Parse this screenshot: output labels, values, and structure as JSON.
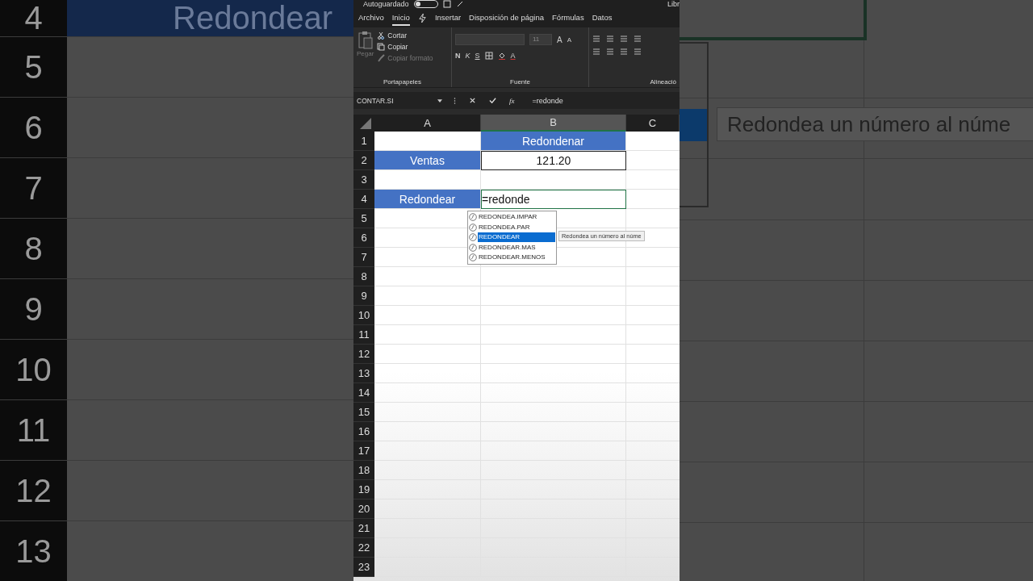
{
  "backdrop_left": {
    "cell_text": "Redondear",
    "row_numbers": [
      "4",
      "5",
      "6",
      "7",
      "8",
      "9",
      "10",
      "11",
      "12",
      "13"
    ]
  },
  "backdrop_right": {
    "tooltip": "Redondea un número al núme"
  },
  "title_bar": {
    "autosave_label": "Autoguardado",
    "autosave_on": false,
    "title": "Libr"
  },
  "menu_tabs": [
    {
      "kind": "text",
      "label": "Archivo",
      "selected": false
    },
    {
      "kind": "text",
      "label": "Inicio",
      "selected": true
    },
    {
      "kind": "icon"
    },
    {
      "kind": "text",
      "label": "Insertar",
      "selected": false
    },
    {
      "kind": "text",
      "label": "Disposición de página",
      "selected": false
    },
    {
      "kind": "text",
      "label": "Fórmulas",
      "selected": false
    },
    {
      "kind": "text",
      "label": "Datos",
      "selected": false
    }
  ],
  "ribbon": {
    "clipboard": {
      "paste": "Pegar",
      "cut": "Cortar",
      "copy": "Copiar",
      "format_painter": "Copiar formato",
      "group": "Portapapeles"
    },
    "font": {
      "size": "11",
      "grow": "A",
      "shrink": "A",
      "bold": "N",
      "italic": "K",
      "underline": "S",
      "font_color_glyph": "A",
      "group": "Fuente"
    },
    "alignment": {
      "group": "Alineació"
    }
  },
  "formula_bar": {
    "name_box": "CONTAR.SI",
    "fx": "fx",
    "formula": "=redonde"
  },
  "columns": [
    {
      "label": "A",
      "selected": false
    },
    {
      "label": "B",
      "selected": true
    },
    {
      "label": "C",
      "selected": false
    }
  ],
  "rows": [
    {
      "number": "1",
      "b": {
        "kind": "header",
        "text": "Redondenar"
      }
    },
    {
      "number": "2",
      "a": {
        "kind": "header",
        "text": "Ventas"
      },
      "b": {
        "kind": "value",
        "text": "121.20"
      }
    },
    {
      "number": "3"
    },
    {
      "number": "4",
      "a": {
        "kind": "header",
        "text": "Redondear"
      },
      "b": {
        "kind": "editing",
        "text": "=redonde"
      }
    },
    {
      "number": "5"
    },
    {
      "number": "6"
    },
    {
      "number": "7"
    },
    {
      "number": "8"
    },
    {
      "number": "9"
    },
    {
      "number": "10"
    },
    {
      "number": "11"
    },
    {
      "number": "12"
    },
    {
      "number": "13"
    },
    {
      "number": "14"
    },
    {
      "number": "15"
    },
    {
      "number": "16"
    },
    {
      "number": "17"
    },
    {
      "number": "18"
    },
    {
      "number": "19"
    },
    {
      "number": "20"
    },
    {
      "number": "21"
    },
    {
      "number": "22"
    },
    {
      "number": "23"
    }
  ],
  "autocomplete": {
    "items": [
      {
        "label": "REDONDEA.IMPAR",
        "selected": false
      },
      {
        "label": "REDONDEA.PAR",
        "selected": false
      },
      {
        "label": "REDONDEAR",
        "selected": true
      },
      {
        "label": "REDONDEAR.MAS",
        "selected": false
      },
      {
        "label": "REDONDEAR.MENOS",
        "selected": false
      }
    ],
    "tooltip": "Redondea un número al núme"
  }
}
